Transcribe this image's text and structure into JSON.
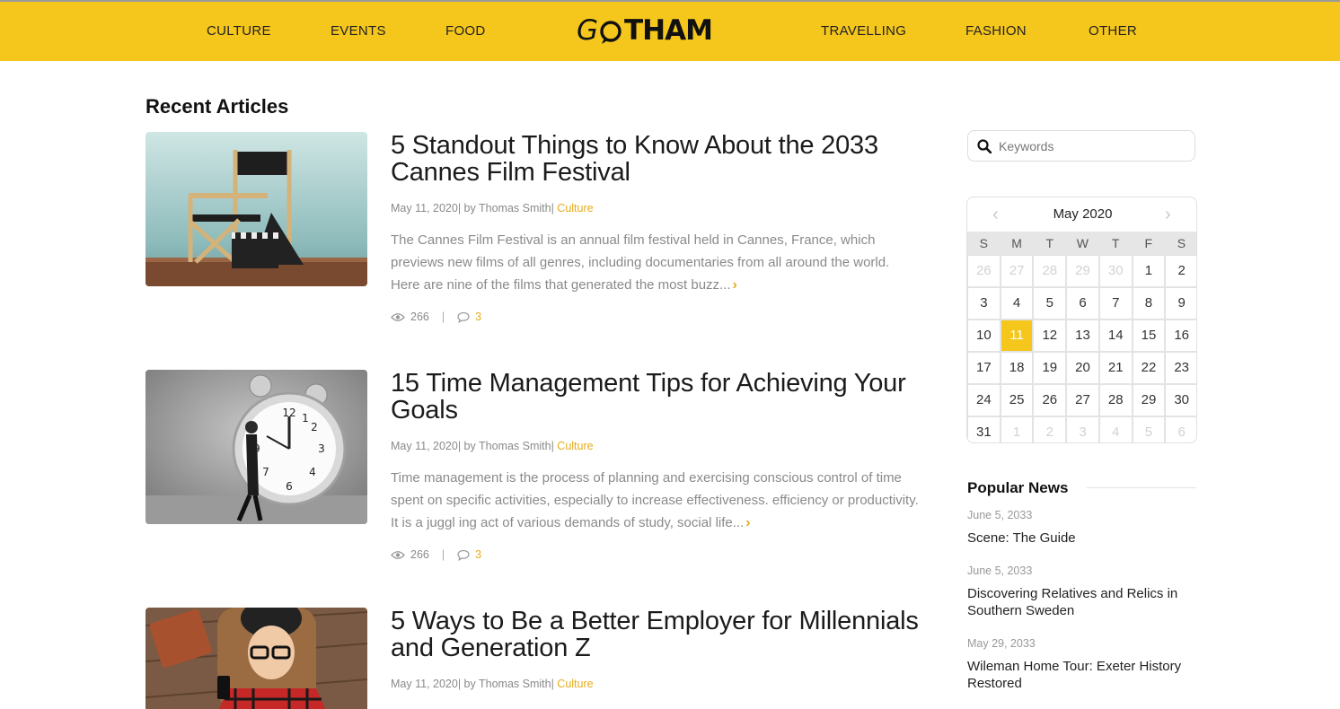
{
  "header": {
    "nav_left": [
      "CULTURE",
      "EVENTS",
      "FOOD"
    ],
    "nav_right": [
      "TRAVELLING",
      "FASHION",
      "OTHER"
    ],
    "logo_text_g": "G",
    "logo_text_rest": "THAM",
    "logo_alt": "GOTHAM",
    "bg_color": "#f5c61c"
  },
  "section": {
    "title": "Recent Articles"
  },
  "articles": [
    {
      "title": "5 Standout Things to Know About the 2033 Cannes Film Festival",
      "meta_date": "May 11, 2020|",
      "meta_by": " by Thomas Smith|",
      "meta_category": " Culture",
      "excerpt": "The Cannes Film Festival is an annual film festival held in Cannes, France, which previews new films of all genres, including documentaries from all around the world. Here are nine of the films that generated the most buzz...",
      "views": "266",
      "separator": "|",
      "comments": "3",
      "thumb_icon": "director-chair-clapperboard-image"
    },
    {
      "title": "15 Time Management Tips for Achieving Your Goals",
      "meta_date": "May 11, 2020|",
      "meta_by": " by Thomas Smith|",
      "meta_category": " Culture",
      "excerpt": "Time management is the process of planning and exercising conscious control of time spent on specific activities, especially to increase effectiveness. efficiency or productivity. It is a juggl ing act of various demands of study, social life...",
      "views": "266",
      "separator": "|",
      "comments": "3",
      "thumb_icon": "alarm-clock-man-image"
    },
    {
      "title": "5 Ways to Be a Better Employer for Millennials and Generation Z",
      "meta_date": "May 11, 2020|",
      "meta_by": " by Thomas Smith|",
      "meta_category": " Culture",
      "thumb_icon": "woman-phone-image"
    }
  ],
  "sidebar": {
    "search_placeholder": "Keywords",
    "calendar": {
      "title": "May 2020",
      "prev": "‹",
      "next": "›",
      "weekdays": [
        "S",
        "M",
        "T",
        "W",
        "T",
        "F",
        "S"
      ],
      "weeks": [
        [
          [
            "26",
            true
          ],
          [
            "27",
            true
          ],
          [
            "28",
            true
          ],
          [
            "29",
            true
          ],
          [
            "30",
            true
          ],
          [
            "1",
            false
          ],
          [
            "2",
            false
          ]
        ],
        [
          [
            "3",
            false
          ],
          [
            "4",
            false
          ],
          [
            "5",
            false
          ],
          [
            "6",
            false
          ],
          [
            "7",
            false
          ],
          [
            "8",
            false
          ],
          [
            "9",
            false
          ]
        ],
        [
          [
            "10",
            false
          ],
          [
            "11",
            false
          ],
          [
            "12",
            false
          ],
          [
            "13",
            false
          ],
          [
            "14",
            false
          ],
          [
            "15",
            false
          ],
          [
            "16",
            false
          ]
        ],
        [
          [
            "17",
            false
          ],
          [
            "18",
            false
          ],
          [
            "19",
            false
          ],
          [
            "20",
            false
          ],
          [
            "21",
            false
          ],
          [
            "22",
            false
          ],
          [
            "23",
            false
          ]
        ],
        [
          [
            "24",
            false
          ],
          [
            "25",
            false
          ],
          [
            "26",
            false
          ],
          [
            "27",
            false
          ],
          [
            "28",
            false
          ],
          [
            "29",
            false
          ],
          [
            "30",
            false
          ]
        ],
        [
          [
            "31",
            false
          ],
          [
            "1",
            true
          ],
          [
            "2",
            true
          ],
          [
            "3",
            true
          ],
          [
            "4",
            true
          ],
          [
            "5",
            true
          ],
          [
            "6",
            true
          ]
        ]
      ],
      "today": "11",
      "today_color": "#f5c61c"
    },
    "popular": {
      "title": "Popular News",
      "items": [
        {
          "date": "June 5, 2033",
          "title": "Scene: The Guide"
        },
        {
          "date": "June 5, 2033",
          "title": "Discovering Relatives and Relics in Southern Sweden"
        },
        {
          "date": "May 29, 2033",
          "title": "Wileman Home Tour: Exeter History Restored"
        }
      ]
    }
  }
}
